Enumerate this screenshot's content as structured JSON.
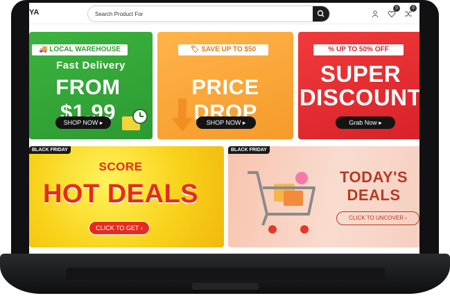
{
  "header": {
    "logo_text": "YA",
    "search_placeholder": "Search Product For",
    "wishlist_count": "0",
    "cart_count": "0"
  },
  "banners": {
    "local_warehouse": {
      "tag": "LOCAL WAREHOUSE",
      "subtitle": "Fast Delivery",
      "headline": "FROM $1.99",
      "button": "SHOP NOW ▸"
    },
    "price_drop": {
      "tag": "SAVE UP TO $50",
      "headline": "PRICE DROP",
      "button": "SHOP NOW ▸"
    },
    "super_discount": {
      "tag": "UP TO 50% OFF",
      "headline_line1": "SUPER",
      "headline_line2": "DISCOUNT",
      "button": "Grab Now ▸"
    },
    "hot_deals": {
      "badge": "BLACK FRIDAY",
      "kicker": "SCORE",
      "headline": "HOT DEALS",
      "button": "CLICK TO GET ›"
    },
    "todays_deals": {
      "badge": "BLACK FRIDAY",
      "headline_line1": "TODAY'S",
      "headline_line2": "DEALS",
      "button": "CLICK TO UNCOVER ›"
    }
  },
  "colors": {
    "green": "#2c9a31",
    "orange": "#f59a2a",
    "red": "#d8222a",
    "yellow": "#f8d21a",
    "peach": "#f9dccf"
  }
}
